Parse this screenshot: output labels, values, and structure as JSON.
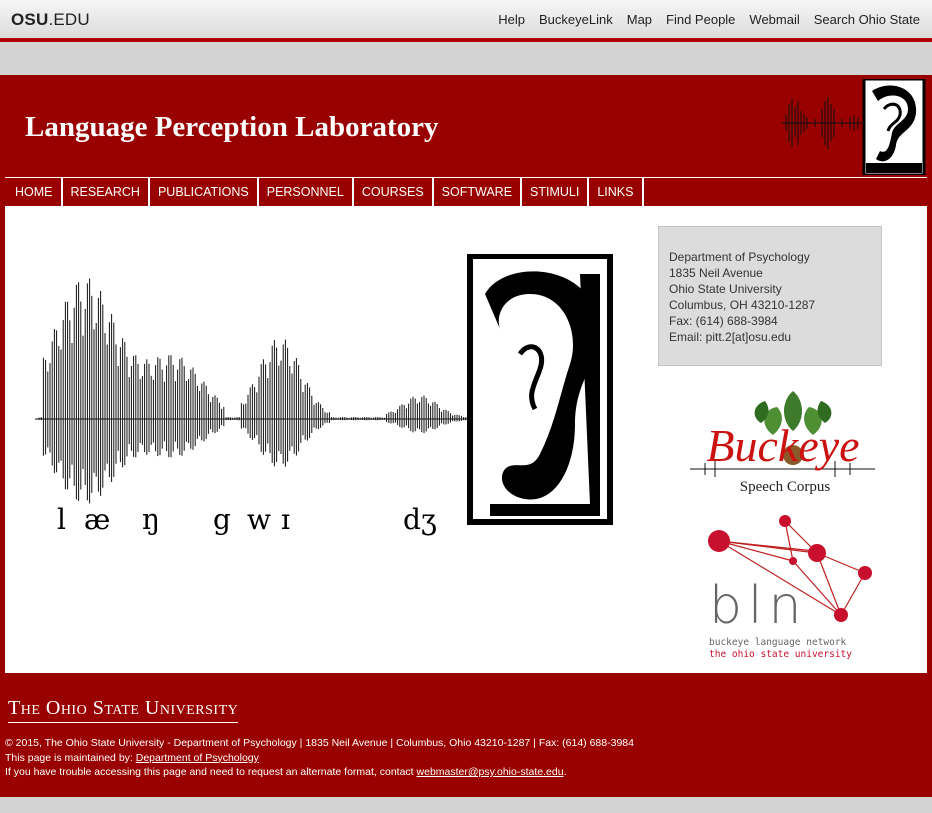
{
  "osu_bar": {
    "logo_bold": "OSU",
    "logo_rest": ".EDU",
    "links": [
      "Help",
      "BuckeyeLink",
      "Map",
      "Find People",
      "Webmail",
      "Search Ohio State"
    ]
  },
  "header": {
    "title": "Language Perception Laboratory"
  },
  "nav": {
    "items": [
      "HOME",
      "RESEARCH",
      "PUBLICATIONS",
      "PERSONNEL",
      "COURSES",
      "SOFTWARE",
      "STIMULI",
      "LINKS"
    ]
  },
  "hero": {
    "ipa": [
      "l",
      "æ",
      "ŋ",
      "g",
      "w",
      "ɪ",
      "dʒ"
    ]
  },
  "address": {
    "lines": [
      "Department of Psychology",
      "1835 Neil Avenue",
      "Ohio State University",
      "Columbus, OH 43210-1287",
      "Fax: (614) 688-3984",
      "Email: pitt.2[at]osu.edu"
    ]
  },
  "buckeye_logo": {
    "word": "Buckeye",
    "caption": "Speech Corpus"
  },
  "bln_logo": {
    "letters": "bln",
    "line1": "buckeye language network",
    "line2": "the ohio state university"
  },
  "footer": {
    "wordmark": "The Ohio State University",
    "copyright": "© 2015, The Ohio State University - Department of Psychology | 1835 Neil Avenue | Columbus, Ohio 43210-1287 | Fax: (614) 688-3984",
    "maintained_prefix": "This page is maintained by: ",
    "maintained_link": "Department of Psychology",
    "access_prefix": "If you have trouble accessing this page and need to request an alternate format, contact ",
    "access_link": "webmaster@psy.ohio-state.edu",
    "access_suffix": "."
  },
  "colors": {
    "scarlet": "#990000",
    "bar_accent": "#b00000",
    "page_bg": "#d3d3d3"
  }
}
